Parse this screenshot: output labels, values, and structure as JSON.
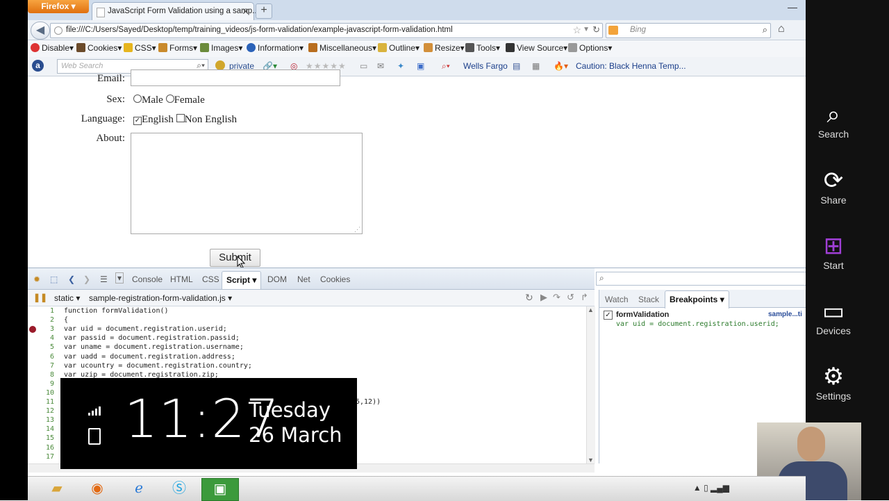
{
  "browser": {
    "app_button": "Firefox",
    "tab_title": "JavaScript Form Validation using a samp...",
    "new_tab": "+",
    "url": "file:///C:/Users/Sayed/Desktop/temp/training_videos/js-form-validation/example-javascript-form-validation.html",
    "search_placeholder": "Bing"
  },
  "webdev_toolbar": [
    "Disable▾",
    "Cookies▾",
    "CSS▾",
    "Forms▾",
    "Images▾",
    "Information▾",
    "Miscellaneous▾",
    "Outline▾",
    "Resize▾",
    "Tools▾",
    "View Source▾",
    "Options▾"
  ],
  "toolbar2": {
    "search_placeholder": "Web Search",
    "private": "private",
    "wells_fargo": "Wells Fargo",
    "caution": "Caution: Black Henna Temp..."
  },
  "form": {
    "email_label": "Email:",
    "sex_label": "Sex:",
    "sex_options": [
      "Male",
      "Female"
    ],
    "language_label": "Language:",
    "language_options": [
      "English",
      "Non English"
    ],
    "language_checked": "English",
    "about_label": "About:",
    "submit_label": "Submit"
  },
  "firebug": {
    "tabs": [
      "Console",
      "HTML",
      "CSS",
      "Script",
      "DOM",
      "Net",
      "Cookies"
    ],
    "active_tab": "Script",
    "script_filter": "static",
    "script_file": "sample-registration-form-validation.js",
    "code_lines": [
      {
        "n": "1",
        "text": "function formValidation()"
      },
      {
        "n": "2",
        "text": "{"
      },
      {
        "n": "3",
        "text": "var uid = document.registration.userid;",
        "breakpoint": true
      },
      {
        "n": "4",
        "text": "var passid = document.registration.passid;"
      },
      {
        "n": "5",
        "text": "var uname = document.registration.username;"
      },
      {
        "n": "6",
        "text": "var uadd = document.registration.address;"
      },
      {
        "n": "7",
        "text": "var ucountry = document.registration.country;"
      },
      {
        "n": "8",
        "text": "var uzip = document.registration.zip;"
      },
      {
        "n": "9",
        "text": ""
      },
      {
        "n": "10",
        "text": ""
      },
      {
        "n": "11",
        "text": "5,12))",
        "offset": true
      },
      {
        "n": "12",
        "text": ""
      },
      {
        "n": "13",
        "text": ""
      },
      {
        "n": "14",
        "text": ""
      },
      {
        "n": "15",
        "text": ""
      },
      {
        "n": "16",
        "text": ""
      },
      {
        "n": "17",
        "text": ""
      }
    ],
    "side_tabs": [
      "Watch",
      "Stack",
      "Breakpoints"
    ],
    "active_side_tab": "Breakpoints",
    "breakpoint": {
      "function": "formValidation",
      "file": "sample...ti",
      "code": "var uid = document.registration.userid;"
    }
  },
  "clock": {
    "time": "11:27",
    "day": "Tuesday",
    "date": "26 March"
  },
  "charms": [
    "Search",
    "Share",
    "Start",
    "Devices",
    "Settings"
  ]
}
